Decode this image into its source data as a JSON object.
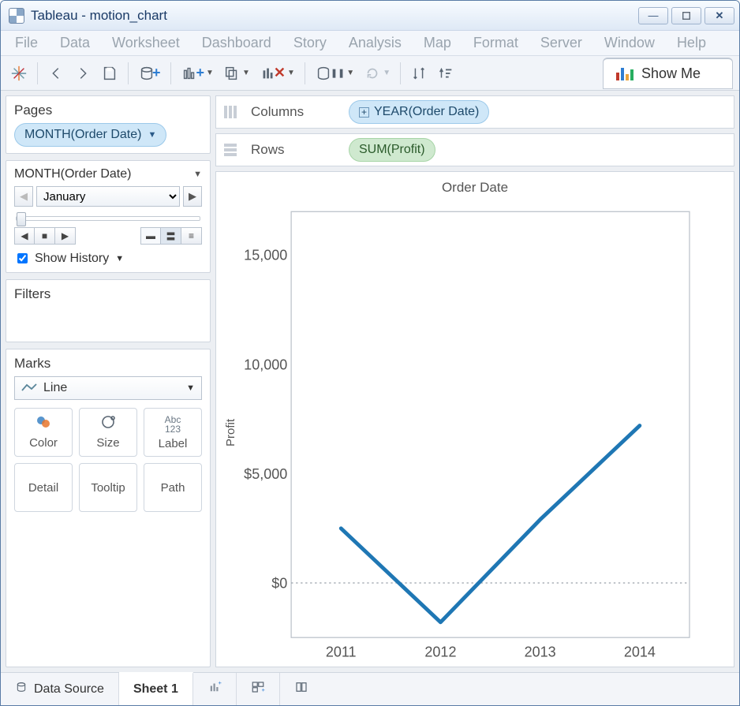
{
  "window": {
    "title": "Tableau - motion_chart"
  },
  "menu": [
    "File",
    "Data",
    "Worksheet",
    "Dashboard",
    "Story",
    "Analysis",
    "Map",
    "Format",
    "Server",
    "Window",
    "Help"
  ],
  "toolbar": {
    "show_me": "Show Me"
  },
  "sidebar": {
    "pages": {
      "title": "Pages",
      "pill": "MONTH(Order Date)",
      "filter_label": "MONTH(Order Date)",
      "selected_month": "January",
      "show_history": "Show History"
    },
    "filters": {
      "title": "Filters"
    },
    "marks": {
      "title": "Marks",
      "type": "Line",
      "cells": [
        "Color",
        "Size",
        "Label",
        "Detail",
        "Tooltip",
        "Path"
      ]
    }
  },
  "shelves": {
    "columns_label": "Columns",
    "rows_label": "Rows",
    "columns_pill": "YEAR(Order Date)",
    "rows_pill": "SUM(Profit)"
  },
  "chart": {
    "title": "Order Date",
    "ylabel": "Profit",
    "yticks": [
      "$15,000",
      "$10,000",
      "$5,000",
      "$0"
    ],
    "xticks": [
      "2011",
      "2012",
      "2013",
      "2014"
    ]
  },
  "chart_data": {
    "type": "line",
    "title": "Order Date",
    "xlabel": "Order Date",
    "ylabel": "Profit",
    "ylim": [
      -2500,
      17000
    ],
    "categories": [
      "2011",
      "2012",
      "2013",
      "2014"
    ],
    "values": [
      2500,
      -1800,
      2900,
      7200
    ]
  },
  "bottom": {
    "data_source": "Data Source",
    "sheet": "Sheet 1"
  }
}
